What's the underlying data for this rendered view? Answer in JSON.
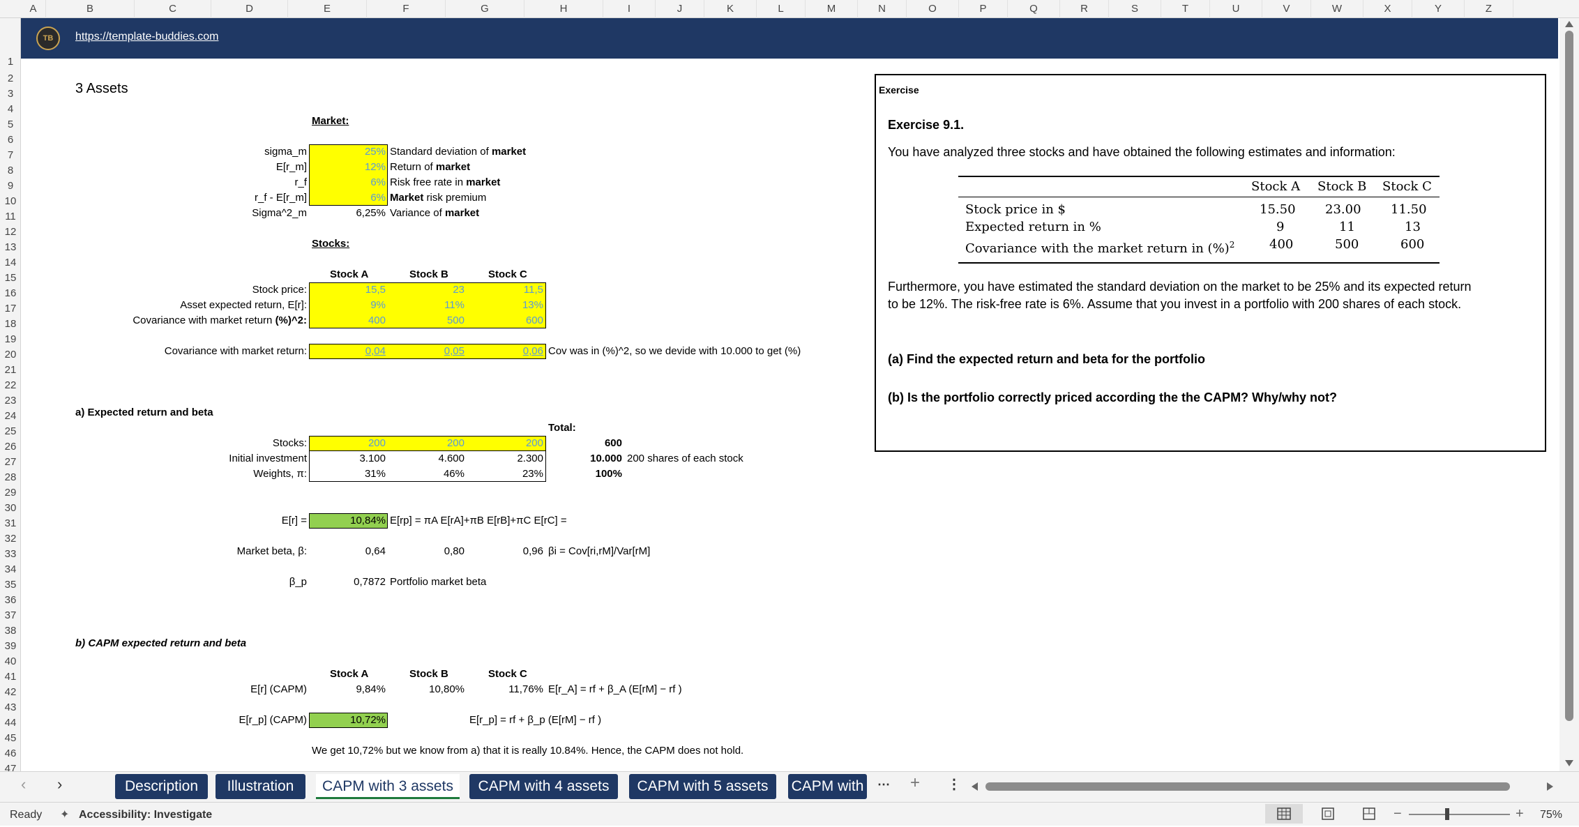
{
  "columns": [
    "A",
    "B",
    "C",
    "D",
    "E",
    "F",
    "G",
    "H",
    "I",
    "J",
    "K",
    "L",
    "M",
    "N",
    "O",
    "P",
    "Q",
    "R",
    "S",
    "T",
    "U",
    "V",
    "W",
    "X",
    "Y",
    "Z"
  ],
  "rows": [
    "1",
    "2",
    "3",
    "4",
    "5",
    "6",
    "7",
    "8",
    "9",
    "10",
    "11",
    "12",
    "13",
    "14",
    "15",
    "16",
    "17",
    "18",
    "19",
    "20",
    "21",
    "22",
    "23",
    "24",
    "25",
    "26",
    "27",
    "28",
    "29",
    "30",
    "31",
    "32",
    "33",
    "34",
    "35",
    "36",
    "37",
    "38",
    "39",
    "40",
    "41",
    "42",
    "43",
    "44",
    "45",
    "46",
    "47"
  ],
  "banner": {
    "url": "https://template-buddies.com",
    "logo_text": "TB"
  },
  "title": "3 Assets",
  "market": {
    "header": "Market:",
    "rows": [
      {
        "label": "sigma_m",
        "value": "25%",
        "desc_plain": "Standard deviation of ",
        "desc_bold": "market"
      },
      {
        "label": "E[r_m]",
        "value": "12%",
        "desc_plain": "Return of ",
        "desc_bold": "market"
      },
      {
        "label": "r_f",
        "value": "6%",
        "desc_plain": "Risk free rate in ",
        "desc_bold": "market"
      },
      {
        "label": "r_f - E[r_m]",
        "value": "6%",
        "desc_bold": "Market",
        "desc_plain": " risk premium"
      },
      {
        "label": "Sigma^2_m",
        "value": "6,25%",
        "desc_plain": "Variance of ",
        "desc_bold": "market"
      }
    ]
  },
  "stocks": {
    "header": "Stocks:",
    "names": [
      "Stock A",
      "Stock B",
      "Stock C"
    ],
    "price_label": "Stock price:",
    "prices": [
      "15,5",
      "23",
      "11,5"
    ],
    "return_label": "Asset expected return, E[r]:",
    "returns": [
      "9%",
      "11%",
      "13%"
    ],
    "cov_label_plain": "Covariance with market return ",
    "cov_label_bold": "(%)^2:",
    "covs": [
      "400",
      "500",
      "600"
    ],
    "cov2_label": "Covariance with market return:",
    "covs2": [
      "0,04",
      "0,05",
      "0,06"
    ],
    "cov2_note": "Cov was in (%)^2, so we devide with 10.000 to get (%)"
  },
  "part_a": {
    "header": "a) Expected return and beta",
    "total_label": "Total:",
    "stocks_label": "Stocks:",
    "shares": [
      "200",
      "200",
      "200"
    ],
    "shares_total": "600",
    "invest_label": "Initial investment",
    "invest": [
      "3.100",
      "4.600",
      "2.300"
    ],
    "invest_total": "10.000",
    "invest_note": "200 shares of each stock",
    "weights_label": "Weights, π:",
    "weights": [
      "31%",
      "46%",
      "23%"
    ],
    "weights_total": "100%",
    "er_label": "E[r] =",
    "er_value": "10,84%",
    "er_formula": "E[rp] = πA E[rA]+πB E[rB]+πC E[rC] =",
    "beta_label": "Market beta, β:",
    "betas": [
      "0,64",
      "0,80",
      "0,96"
    ],
    "beta_formula": "βi = Cov[ri,rM]/Var[rM]",
    "bp_label": "β_p",
    "bp_value": "0,7872",
    "bp_note": "Portfolio market beta"
  },
  "part_b": {
    "header": "b) CAPM expected return and beta",
    "names": [
      "Stock A",
      "Stock B",
      "Stock C"
    ],
    "er_capm_label": "E[r] (CAPM)",
    "er_capm": [
      "9,84%",
      "10,80%",
      "11,76%"
    ],
    "er_capm_formula": "E[r_A] = rf + β_A (E[rM] − rf )",
    "erp_label": "E[r_p] (CAPM)",
    "erp_value": "10,72%",
    "erp_formula": "E[r_p] = rf + β_p (E[rM] − rf )",
    "conclusion": "We get 10,72% but we know from a)  that it is really 10.84%. Hence, the CAPM does not hold."
  },
  "exercise": {
    "box_title": "Exercise",
    "heading": "Exercise 9.1.",
    "intro": "You have analyzed three stocks and have obtained the following estimates and information:",
    "table": {
      "headers": [
        "Stock A",
        "Stock B",
        "Stock C"
      ],
      "rows": [
        {
          "label": "Stock price in $",
          "values": [
            "15.50",
            "23.00",
            "11.50"
          ]
        },
        {
          "label": "Expected return in %",
          "values": [
            "9",
            "11",
            "13"
          ]
        },
        {
          "label": "Covariance with the market return in (%)",
          "sup": "2",
          "values": [
            "400",
            "500",
            "600"
          ]
        }
      ]
    },
    "para1": "Furthermore, you have estimated the standard deviation on the market to be 25% and its expected return",
    "para2": "to be 12%. The risk-free rate is 6%. Assume that you invest in a portfolio with 200 shares of each stock.",
    "q_a": "(a) Find the expected return and beta for the portfolio",
    "q_b": "(b) Is the portfolio correctly priced according the the CAPM? Why/why not?"
  },
  "sheet_tabs": [
    "Description",
    "Illustration",
    "CAPM with 3 assets",
    "CAPM with 4 assets",
    "CAPM with 5 assets",
    "CAPM with"
  ],
  "active_tab": "CAPM with 3 assets",
  "status": {
    "ready": "Ready",
    "accessibility": "Accessibility: Investigate",
    "zoom": "75%"
  },
  "colors": {
    "banner": "#1f3864",
    "highlight": "#ffff00",
    "green": "#92d050",
    "input_text": "#5b9bd5"
  }
}
